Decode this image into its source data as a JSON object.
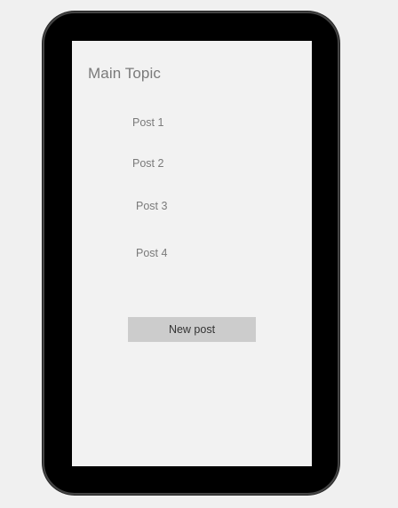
{
  "screen": {
    "title": "Main Topic",
    "posts": [
      {
        "label": "Post 1"
      },
      {
        "label": "Post 2"
      },
      {
        "label": "Post 3"
      },
      {
        "label": "Post 4"
      }
    ],
    "new_post_label": "New post"
  },
  "colors": {
    "page_background": "#f0f0f0",
    "device_frame": "#000000",
    "screen_background": "#f2f2f2",
    "text_muted": "#7a7a7a",
    "button_background": "#cccccc",
    "button_text": "#333333"
  }
}
